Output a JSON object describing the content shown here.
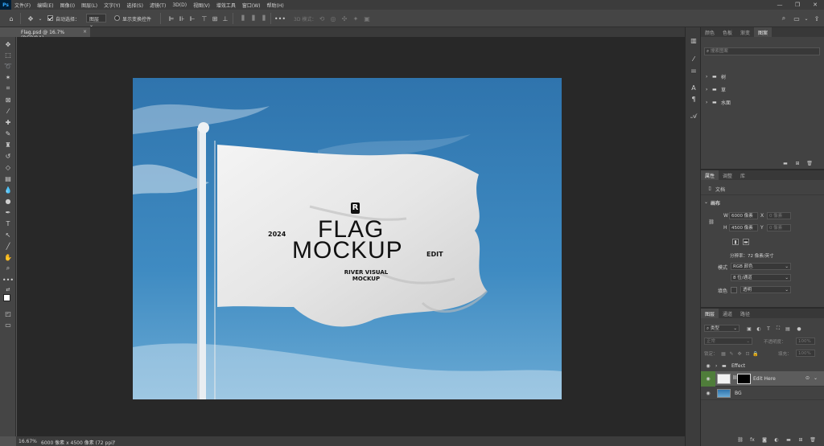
{
  "app": {
    "logo": "Ps"
  },
  "menu": [
    "文件(F)",
    "编辑(E)",
    "图像(I)",
    "图层(L)",
    "文字(Y)",
    "选择(S)",
    "滤镜(T)",
    "3D(D)",
    "视图(V)",
    "增效工具",
    "窗口(W)",
    "帮助(H)"
  ],
  "window_controls": {
    "minimize": "—",
    "restore": "❐",
    "close": "✕"
  },
  "options": {
    "auto_select_label": "自动选择：",
    "auto_select_value": "图层",
    "show_transform_label": "显示变换控件",
    "mode_3d_label": "3D 模式："
  },
  "document": {
    "tab_title": "Flag.psd @ 16.7%(RGB/8#)",
    "close": "×"
  },
  "status": {
    "zoom": "16.67%",
    "size": "6000 像素 x 4500 像素 (72 ppi)",
    "arrow": "›"
  },
  "artwork": {
    "logo_letter": "R",
    "year": "2024",
    "line1": "FLAG",
    "line2": "MOCKUP",
    "edit": "EDIT",
    "brand1": "RIVER VISUAL",
    "brand2": "MOCKUP"
  },
  "panel_top": {
    "tabs": [
      "颜色",
      "色板",
      "渐变",
      "图案"
    ],
    "active_tab": 3,
    "search_placeholder": "搜索图案",
    "groups": [
      "树",
      "草",
      "水面"
    ]
  },
  "properties": {
    "tabs": [
      "属性",
      "调整",
      "库"
    ],
    "active_tab": 0,
    "doc_label": "文档",
    "section": "画布",
    "w_label": "W",
    "w_value": "6000 像素",
    "x_label": "X",
    "x_value": "0 像素",
    "h_label": "H",
    "h_value": "4500 像素",
    "y_label": "Y",
    "y_value": "0 像素",
    "resolution": "分辨率：72 像素/英寸",
    "mode_label": "模式",
    "mode_value": "RGB 颜色",
    "depth_value": "8 位/通道",
    "fill_label": "填色",
    "fill_value": "透明"
  },
  "layers": {
    "tabs": [
      "图层",
      "通道",
      "路径"
    ],
    "active_tab": 0,
    "filter_value": "类型",
    "blend_value": "正常",
    "opacity_label": "不透明度：",
    "opacity_value": "100%",
    "lock_label": "锁定：",
    "fill_label": "填充：",
    "fill_value": "100%",
    "items": [
      {
        "name": "Effect",
        "kind": "group",
        "selected": false
      },
      {
        "name": "Edit Here",
        "kind": "smart",
        "selected": true
      },
      {
        "name": "BG",
        "kind": "image",
        "selected": false
      }
    ]
  }
}
